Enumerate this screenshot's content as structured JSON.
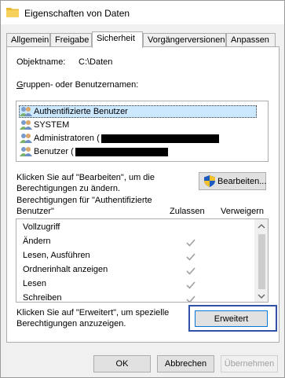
{
  "window": {
    "title": "Eigenschaften von Daten",
    "title_icon": "folder-icon"
  },
  "tabs": [
    {
      "label": "Allgemein",
      "active": false
    },
    {
      "label": "Freigabe",
      "active": false
    },
    {
      "label": "Sicherheit",
      "active": true
    },
    {
      "label": "Vorgängerversionen",
      "active": false
    },
    {
      "label": "Anpassen",
      "active": false
    }
  ],
  "object": {
    "label": "Objektname:",
    "value": "C:\\Daten"
  },
  "groups": {
    "label": "Gruppen- oder Benutzernamen:",
    "items": [
      {
        "label": "Authentifizierte Benutzer",
        "icon": "users-icon",
        "selected": true
      },
      {
        "label": "SYSTEM",
        "icon": "users-icon",
        "selected": false
      },
      {
        "label": "Administratoren (",
        "icon": "users-icon",
        "selected": false,
        "redacted": true
      },
      {
        "label": "Benutzer (",
        "icon": "users-icon",
        "selected": false,
        "redacted": true
      }
    ]
  },
  "edit": {
    "hint": "Klicken Sie auf \"Bearbeiten\", um die Berechtigungen zu ändern.",
    "hint_line1": "Klicken Sie auf \"Bearbeiten\", um die",
    "hint_line2": "Berechtigungen zu ändern.",
    "button": "Bearbeiten...",
    "button_icon": "uac-shield-icon"
  },
  "permissions": {
    "title_line1": "Berechtigungen für \"Authentifizierte",
    "title_line2": "Benutzer\"",
    "col_allow": "Zulassen",
    "col_deny": "Verweigern",
    "rows": [
      {
        "label": "Vollzugriff",
        "allow": false,
        "deny": false
      },
      {
        "label": "Ändern",
        "allow": true,
        "deny": false
      },
      {
        "label": "Lesen, Ausführen",
        "allow": true,
        "deny": false
      },
      {
        "label": "Ordnerinhalt anzeigen",
        "allow": true,
        "deny": false
      },
      {
        "label": "Lesen",
        "allow": true,
        "deny": false
      },
      {
        "label": "Schreiben",
        "allow": true,
        "deny": false
      }
    ]
  },
  "advanced": {
    "hint_line1": "Klicken Sie auf \"Erweitert\", um spezielle",
    "hint_line2": "Berechtigungen anzuzeigen.",
    "button": "Erweitert"
  },
  "footer": {
    "ok": "OK",
    "cancel": "Abbrechen",
    "apply": "Übernehmen"
  },
  "colors": {
    "highlight_border": "#2f52a8",
    "selected_row": "#cce8ff",
    "check_disabled": "#a0a0a0"
  }
}
